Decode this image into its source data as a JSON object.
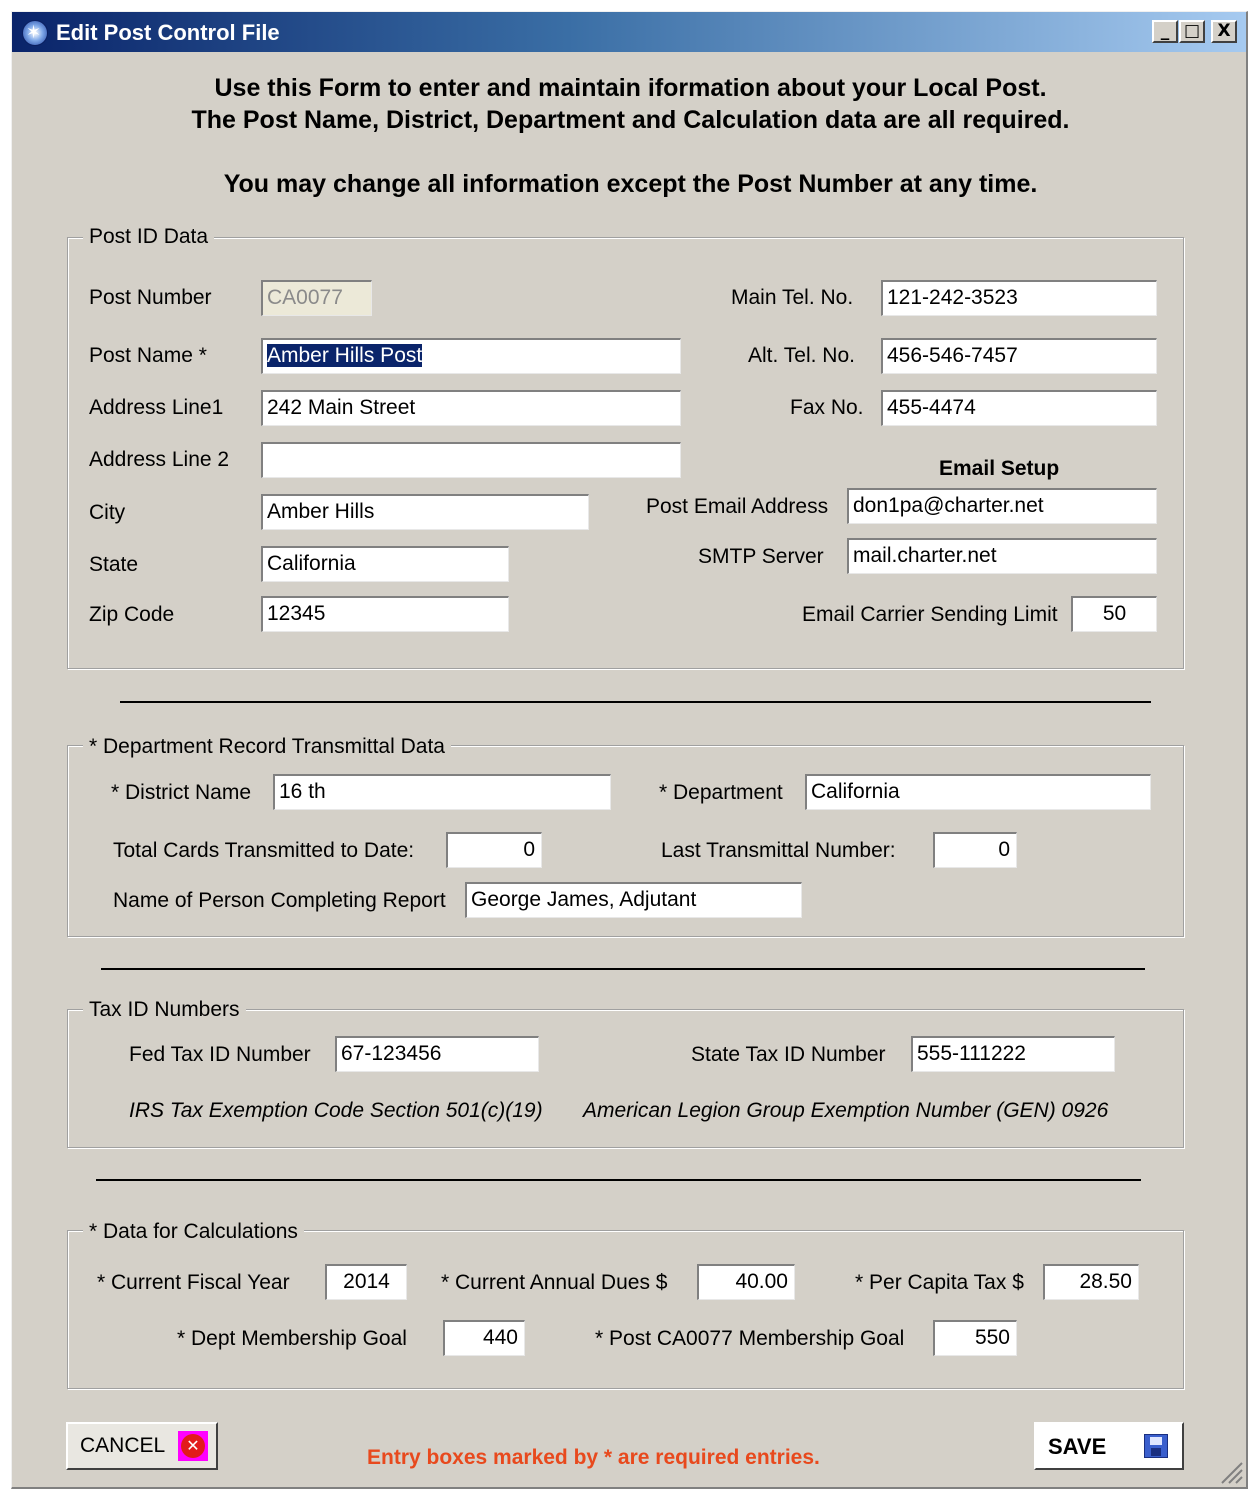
{
  "window": {
    "title": "Edit Post Control File",
    "controls": {
      "minimize": "_",
      "maximize": "□",
      "close": "X"
    }
  },
  "header": {
    "line1": "Use this Form to enter and maintain iformation about your Local Post.",
    "line2": "The Post Name, District, Department and Calculation data are all required.",
    "line3": "You may change all information except the Post Number at any time."
  },
  "post_id": {
    "legend": "Post ID Data",
    "post_number_label": "Post Number",
    "post_number": "CA0077",
    "post_name_label": "Post Name *",
    "post_name": "Amber Hills Post",
    "address1_label": "Address Line1",
    "address1": "242 Main Street",
    "address2_label": "Address Line 2",
    "address2": "",
    "city_label": "City",
    "city": "Amber Hills",
    "state_label": "State",
    "state": "California",
    "zip_label": "Zip Code",
    "zip": "12345",
    "main_tel_label": "Main Tel. No.",
    "main_tel": "121-242-3523",
    "alt_tel_label": "Alt. Tel. No.",
    "alt_tel": "456-546-7457",
    "fax_label": "Fax No.",
    "fax": "455-4474",
    "email_setup_heading": "Email Setup",
    "email_label": "Post Email Address",
    "email": "don1pa@charter.net",
    "smtp_label": "SMTP Server",
    "smtp": "mail.charter.net",
    "send_limit_label": "Email Carrier Sending Limit",
    "send_limit": "50"
  },
  "department": {
    "legend": "* Department Record Transmittal Data",
    "district_label": "* District Name",
    "district": "16 th",
    "department_label": "* Department",
    "department": "California",
    "total_cards_label": "Total Cards Transmitted to Date:",
    "total_cards": "0",
    "last_transmittal_label": "Last Transmittal Number:",
    "last_transmittal": "0",
    "person_label": "Name of Person Completing Report",
    "person": "George James, Adjutant"
  },
  "tax": {
    "legend": "Tax ID Numbers",
    "fed_label": "Fed Tax ID Number",
    "fed": "67-123456",
    "state_label": "State Tax ID Number",
    "state": "555-111222",
    "irs_note": "IRS Tax Exemption Code Section 501(c)(19)",
    "gen_note": "American Legion Group Exemption Number (GEN) 0926"
  },
  "calc": {
    "legend": "* Data for Calculations",
    "fiscal_year_label": "* Current Fiscal Year",
    "fiscal_year": "2014",
    "annual_dues_label": "* Current Annual Dues  $",
    "annual_dues": "40.00",
    "per_capita_label": "* Per Capita Tax $",
    "per_capita": "28.50",
    "dept_goal_label": "* Dept Membership Goal",
    "dept_goal": "440",
    "post_goal_label": "* Post CA0077 Membership Goal",
    "post_goal": "550"
  },
  "footer": {
    "cancel_label": "CANCEL",
    "save_label": "SAVE",
    "required_note": "Entry boxes marked by  *  are required entries.",
    "note_color": "#e8491d"
  }
}
